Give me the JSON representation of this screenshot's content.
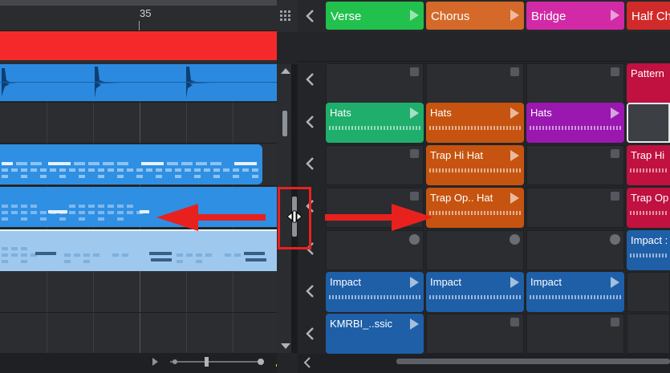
{
  "ruler": {
    "bar_number": "35"
  },
  "scenes": [
    {
      "label": "Verse",
      "color": "#22c04c"
    },
    {
      "label": "Chorus",
      "color": "#d4692a"
    },
    {
      "label": "Bridge",
      "color": "#d22aa6"
    },
    {
      "label": "Half Ch",
      "color": "#d12a2a"
    }
  ],
  "clips": {
    "pattern": "Pattern",
    "hats_verse": "Hats",
    "hats_chorus": "Hats",
    "hats_bridge": "Hats",
    "trap_hi_hat_chorus": "Trap Hi Hat",
    "trap_hi_half": "Trap Hi",
    "trap_op_hat_chorus": "Trap Op.. Hat",
    "trap_op_half": "Trap Op",
    "impact_half": "Impact :",
    "impact_verse": "Impact",
    "impact_chorus": "Impact",
    "impact_bridge": "Impact",
    "kmrbi": "KMRBI_..ssic"
  },
  "colors": {
    "track_red": "#f5292a",
    "clip_green": "#1fae6b",
    "clip_orange": "#c65410",
    "clip_purple": "#9a17b0",
    "clip_crimson": "#c01140",
    "clip_blue": "#1e5fa8",
    "annotation_red": "#e8211f"
  }
}
